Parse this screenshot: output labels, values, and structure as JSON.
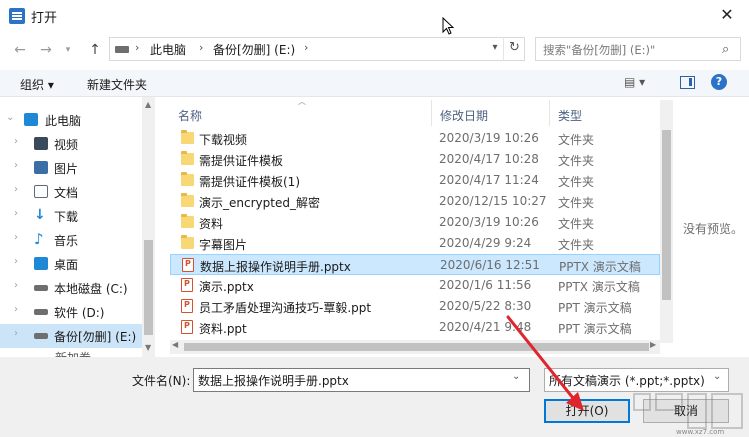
{
  "window": {
    "title": "打开",
    "close_glyph": "✕"
  },
  "address": {
    "segments": [
      "此电脑",
      "备份[勿删] (E:)"
    ],
    "search_placeholder": "搜索\"备份[勿删] (E:)\""
  },
  "toolbar": {
    "organize": "组织 ▾",
    "new_folder": "新建文件夹",
    "view_glyph": "▤ ▾"
  },
  "tree": {
    "items": [
      {
        "label": "此电脑",
        "icon": "computer-icon",
        "color": "#1e88d6"
      },
      {
        "label": "视频",
        "icon": "video-folder-icon",
        "color": "#3b4a5a"
      },
      {
        "label": "图片",
        "icon": "pictures-folder-icon",
        "color": "#3b6ea5"
      },
      {
        "label": "文档",
        "icon": "documents-folder-icon",
        "color": "#5a6c80"
      },
      {
        "label": "下载",
        "icon": "downloads-folder-icon",
        "color": "#1e88d6"
      },
      {
        "label": "音乐",
        "icon": "music-folder-icon",
        "color": "#1e88d6"
      },
      {
        "label": "桌面",
        "icon": "desktop-folder-icon",
        "color": "#1e88d6"
      },
      {
        "label": "本地磁盘 (C:)",
        "icon": "windows-drive-icon",
        "color": "#6e6e6e"
      },
      {
        "label": "软件 (D:)",
        "icon": "drive-icon",
        "color": "#6e6e6e"
      },
      {
        "label": "备份[勿删] (E:)",
        "icon": "drive-icon",
        "color": "#6e6e6e"
      }
    ],
    "cut_item": "新加卷"
  },
  "columns": {
    "name": "名称",
    "date": "修改日期",
    "type": "类型"
  },
  "files": [
    {
      "name": "下载视频",
      "date": "2020/3/19 10:26",
      "type": "文件夹",
      "kind": "folder"
    },
    {
      "name": "需提供证件模板",
      "date": "2020/4/17 10:28",
      "type": "文件夹",
      "kind": "folder"
    },
    {
      "name": "需提供证件模板(1)",
      "date": "2020/4/17 11:24",
      "type": "文件夹",
      "kind": "folder"
    },
    {
      "name": "演示_encrypted_解密",
      "date": "2020/12/15 10:27",
      "type": "文件夹",
      "kind": "folder"
    },
    {
      "name": "资料",
      "date": "2020/3/19 10:26",
      "type": "文件夹",
      "kind": "folder"
    },
    {
      "name": "字幕图片",
      "date": "2020/4/29 9:24",
      "type": "文件夹",
      "kind": "folder"
    },
    {
      "name": "数据上报操作说明手册.pptx",
      "date": "2020/6/16 12:51",
      "type": "PPTX 演示文稿",
      "kind": "ppt"
    },
    {
      "name": "演示.pptx",
      "date": "2020/1/6 11:56",
      "type": "PPTX 演示文稿",
      "kind": "ppt"
    },
    {
      "name": "员工矛盾处理沟通技巧-覃毅.ppt",
      "date": "2020/5/22 8:30",
      "type": "PPT 演示文稿",
      "kind": "ppt"
    },
    {
      "name": "资料.ppt",
      "date": "2020/4/21 9:48",
      "type": "PPT 演示文稿",
      "kind": "ppt"
    }
  ],
  "selected_index": 6,
  "preview_text": "没有预览。",
  "bottom": {
    "filename_label": "文件名(N):",
    "filename_value": "数据上报操作说明手册.pptx",
    "filetype_value": "所有文稿演示 (*.ppt;*.pptx)",
    "open_button": "打开(O)",
    "cancel_button": "取消"
  },
  "watermark": "www.xz7.com",
  "colors": {
    "accent": "#0078d7",
    "selection": "#cce8ff",
    "arrow": "#e0252c"
  }
}
